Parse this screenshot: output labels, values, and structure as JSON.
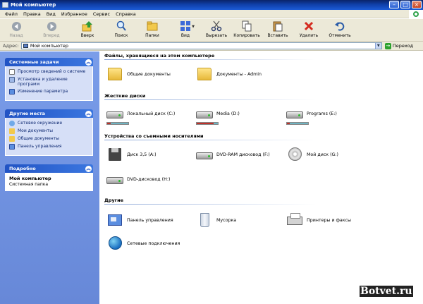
{
  "window": {
    "title": "Мой компьютер"
  },
  "menu": {
    "items": [
      "Файл",
      "Правка",
      "Вид",
      "Избранное",
      "Сервис",
      "Справка"
    ]
  },
  "toolbar": {
    "buttons": [
      {
        "label": "Назад",
        "icon": "back-arrow-icon",
        "enabled": false
      },
      {
        "label": "Вперед",
        "icon": "forward-arrow-icon",
        "enabled": false
      },
      {
        "label": "Вверх",
        "icon": "up-folder-icon",
        "enabled": true
      },
      {
        "label": "Поиск",
        "icon": "search-icon",
        "enabled": true
      },
      {
        "label": "Папки",
        "icon": "folders-icon",
        "enabled": true
      },
      {
        "label": "Вид",
        "icon": "views-icon",
        "enabled": true
      },
      {
        "label": "Вырезать",
        "icon": "cut-icon",
        "enabled": true
      },
      {
        "label": "Копировать",
        "icon": "copy-icon",
        "enabled": true
      },
      {
        "label": "Вставить",
        "icon": "paste-icon",
        "enabled": true
      },
      {
        "label": "Удалить",
        "icon": "delete-icon",
        "enabled": true
      },
      {
        "label": "Отменить",
        "icon": "undo-icon",
        "enabled": true
      }
    ]
  },
  "address": {
    "label": "Адрес:",
    "value": "Мой компьютер",
    "go_label": "Переход"
  },
  "taskpane": {
    "system_tasks": {
      "title": "Системные задачи",
      "items": [
        "Просмотр сведений о системе",
        "Установка и удаление программ",
        "Изменение параметра"
      ]
    },
    "other_places": {
      "title": "Другие места",
      "items": [
        "Сетевое окружение",
        "Мои документы",
        "Общие документы",
        "Панель управления"
      ]
    },
    "details": {
      "title": "Подробно",
      "name": "Мой компьютер",
      "type": "Системная папка"
    }
  },
  "sections": {
    "files": {
      "title": "Файлы, хранящиеся на этом компьютере",
      "items": [
        "Общие документы",
        "Документы - Admin"
      ]
    },
    "hard_drives": {
      "title": "Жесткие диски",
      "items": [
        {
          "label": "Локальный диск (C:)",
          "used": 0.18
        },
        {
          "label": "Media (D:)",
          "used": 0.8
        },
        {
          "label": "Programs (E:)",
          "used": 0.12
        }
      ]
    },
    "removable": {
      "title": "Устройства со съемными носителями",
      "items": [
        "Диск 3,5 (A:)",
        "DVD-RAM дисковод (F:)",
        "Мой диск (G:)",
        "DVD-дисковод (H:)"
      ]
    },
    "other": {
      "title": "Другие",
      "items": [
        "Панель управления",
        "Мусорка",
        "Принтеры и факсы",
        "Сетевые подключения"
      ]
    }
  },
  "watermark": {
    "text": "Botvet.ru"
  },
  "colors": {
    "title_bar": "#0a246a",
    "task_pane": "#7a9de9",
    "link_text": "#0c2770"
  }
}
